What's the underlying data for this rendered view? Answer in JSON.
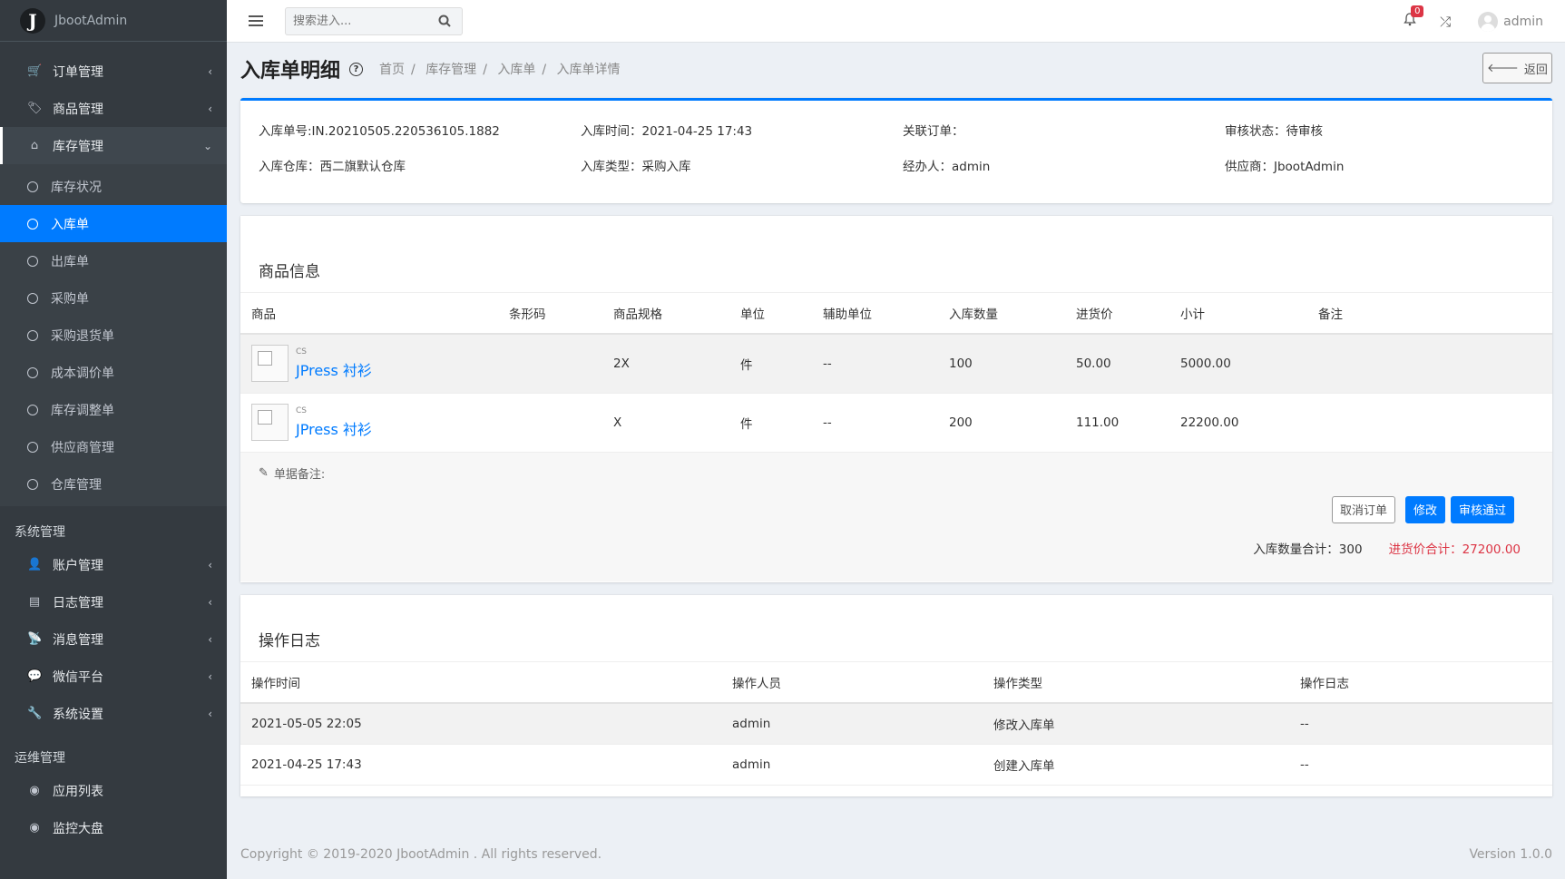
{
  "brand": {
    "logo_letter": "J",
    "name": "JbootAdmin"
  },
  "sidebar": {
    "items_main": [
      {
        "label": "订单管理",
        "icon": "cart-icon"
      },
      {
        "label": "商品管理",
        "icon": "tag-icon"
      },
      {
        "label": "库存管理",
        "icon": "warehouse-icon"
      }
    ],
    "stock_submenu": [
      {
        "label": "库存状况"
      },
      {
        "label": "入库单"
      },
      {
        "label": "出库单"
      },
      {
        "label": "采购单"
      },
      {
        "label": "采购退货单"
      },
      {
        "label": "成本调价单"
      },
      {
        "label": "库存调整单"
      },
      {
        "label": "供应商管理"
      },
      {
        "label": "仓库管理"
      }
    ],
    "section_system": "系统管理",
    "items_system": [
      {
        "label": "账户管理",
        "icon": "user-icon"
      },
      {
        "label": "日志管理",
        "icon": "book-icon"
      },
      {
        "label": "消息管理",
        "icon": "broadcast-icon"
      },
      {
        "label": "微信平台",
        "icon": "wechat-icon"
      },
      {
        "label": "系统设置",
        "icon": "wrench-icon"
      }
    ],
    "section_ops": "运维管理",
    "items_ops": [
      {
        "label": "应用列表",
        "icon": "dashboard-icon"
      },
      {
        "label": "监控大盘",
        "icon": "gauge-icon"
      }
    ]
  },
  "topbar": {
    "search_placeholder": "搜索进入...",
    "notif_count": "0",
    "user_name": "admin"
  },
  "page": {
    "title": "入库单明细",
    "breadcrumbs": [
      "首页",
      "库存管理",
      "入库单",
      "入库单详情"
    ],
    "back_label": "返回"
  },
  "info": {
    "order_no": "入库单号:IN.20210505.220536105.1882",
    "time": "入库时间：2021-04-25 17:43",
    "related": "关联订单：",
    "status": "审核状态：待审核",
    "warehouse": "入库仓库：西二旗默认仓库",
    "type": "入库类型：采购入库",
    "handler": "经办人：admin",
    "supplier": "供应商：JbootAdmin"
  },
  "goods": {
    "title": "商品信息",
    "headers": [
      "商品",
      "条形码",
      "商品规格",
      "单位",
      "辅助单位",
      "入库数量",
      "进货价",
      "小计",
      "备注"
    ],
    "rows": [
      {
        "code": "CS",
        "name": "JPress 衬衫",
        "barcode": "",
        "spec": "2X",
        "unit": "件",
        "aux": "--",
        "qty": "100",
        "price": "50.00",
        "subtotal": "5000.00",
        "note": ""
      },
      {
        "code": "CS",
        "name": "JPress 衬衫",
        "barcode": "",
        "spec": "X",
        "unit": "件",
        "aux": "--",
        "qty": "200",
        "price": "111.00",
        "subtotal": "22200.00",
        "note": ""
      }
    ],
    "remark_label": "单据备注:",
    "cancel_label": "取消订单",
    "edit_label": "修改",
    "approve_label": "审核通过",
    "total_qty": "入库数量合计：300",
    "total_price": "进货价合计：27200.00"
  },
  "log": {
    "title": "操作日志",
    "headers": [
      "操作时间",
      "操作人员",
      "操作类型",
      "操作日志"
    ],
    "rows": [
      {
        "time": "2021-05-05 22:05",
        "user": "admin",
        "type": "修改入库单",
        "detail": "--"
      },
      {
        "time": "2021-04-25 17:43",
        "user": "admin",
        "type": "创建入库单",
        "detail": "--"
      }
    ]
  },
  "footer": {
    "copyright": "Copyright © 2019-2020 JbootAdmin . All rights reserved.",
    "version": "Version 1.0.0"
  }
}
